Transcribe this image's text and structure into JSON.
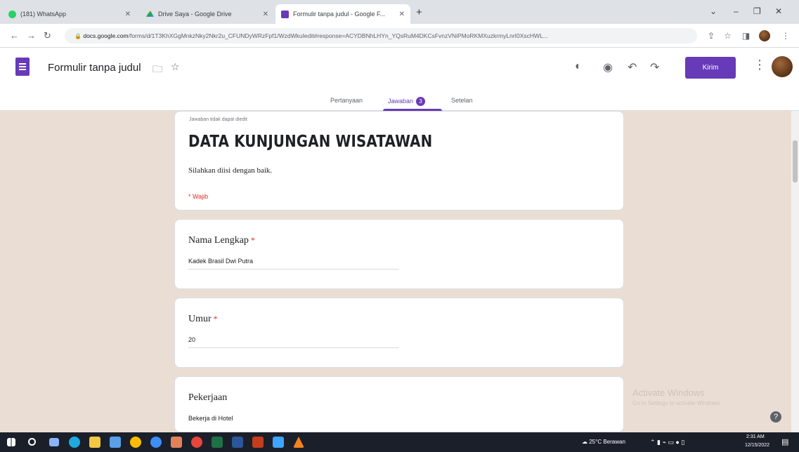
{
  "browser": {
    "tabs": [
      {
        "label": "(181) WhatsApp",
        "color": "#25d366"
      },
      {
        "label": "Drive Saya - Google Drive",
        "color": "#1fa463"
      },
      {
        "label": "Formulir tanpa judul - Google F...",
        "color": "#673ab7"
      }
    ],
    "new_tab": "+",
    "url_host": "docs.google.com",
    "url_path": "/forms/d/1T3KhXGgMnkzNky2Nkr2u_CFUNDyWRzFpf1/WzdWkuIedit#response=ACYDBNhLHYn_YQsRuM4DKCsFvnzVNiPMoRKMXuzkrmyLnrI0XscHWL...",
    "window_controls": [
      "⌄",
      "–",
      "❐",
      "✕"
    ]
  },
  "form": {
    "title": "Formulir tanpa judul",
    "send_label": "Kirim",
    "tabs": {
      "questions": "Pertanyaan",
      "responses": "Jawaban",
      "responses_count": "3",
      "settings": "Setelan"
    }
  },
  "header_card": {
    "note": "Jawaban tidak dapat diedit",
    "title": "DATA KUNJUNGAN WISATAWAN",
    "description": "Silahkan diisi dengan baik.",
    "required_note": "* Wajib"
  },
  "questions": [
    {
      "label": "Nama Lengkap",
      "required": "*",
      "answer": "Kadek Brasil Dwi Putra"
    },
    {
      "label": "Umur",
      "required": "*",
      "answer": "20"
    },
    {
      "label": "Pekerjaan",
      "required": "",
      "answer": "Bekerja di Hotel"
    }
  ],
  "watermark": {
    "line1": "Activate Windows",
    "line2": "Go to Settings to activate Windows."
  },
  "taskbar": {
    "weather": "25°C Berawan",
    "time": "2:31 AM",
    "date": "12/15/2022"
  }
}
